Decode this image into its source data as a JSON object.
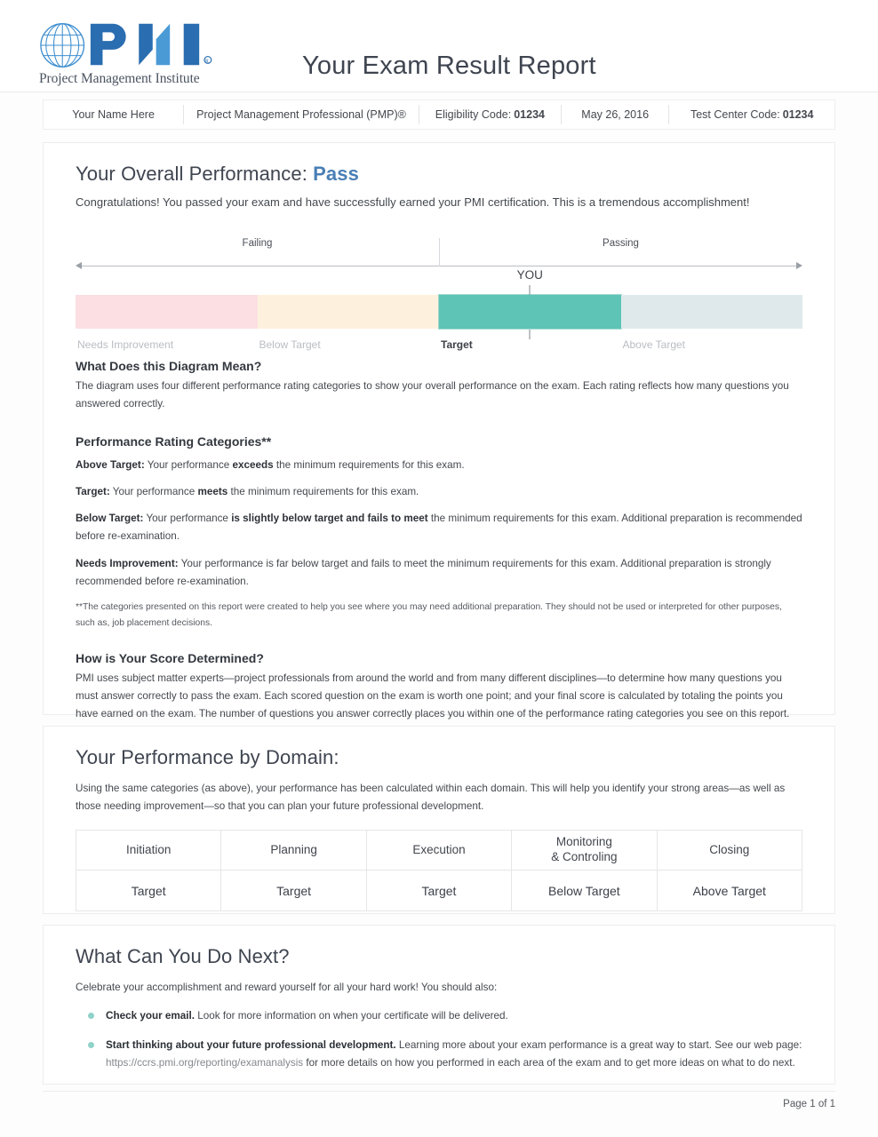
{
  "header": {
    "logo_tagline": "Project Management Institute",
    "report_title": "Your Exam Result Report"
  },
  "infobar": {
    "candidate_name": "Your Name Here",
    "credential": "Project Management Professional (PMP)®",
    "eligibility_label": "Eligibility Code:",
    "eligibility_code": "01234",
    "exam_date": "May 26, 2016",
    "test_center_label": "Test Center Code:",
    "test_center_code": "01234"
  },
  "overall": {
    "title_prefix": "Your Overall Performance:",
    "result": "Pass",
    "congrats": "Congratulations! You passed your exam and have successfully earned your PMI certification. This is a tremendous accomplishment!",
    "diagram_heading": "What Does this Diagram Mean?",
    "diagram_text": "The diagram uses four different performance rating categories to show your overall performance on the exam. Each rating reflects how many questions you answered correctly.",
    "categories_heading": "Performance Rating Categories**",
    "categories": [
      {
        "name": "Above Target:",
        "pre": " Your performance ",
        "emph": "exceeds",
        "post": " the minimum requirements for this exam."
      },
      {
        "name": "Target:",
        "pre": " Your performance ",
        "emph": "meets",
        "post": " the minimum requirements for this exam."
      },
      {
        "name": "Below Target:",
        "pre": " Your performance ",
        "emph": "is slightly below target and fails to meet",
        "post": " the minimum requirements for this exam. Additional preparation is recommended before re-examination."
      },
      {
        "name": "Needs Improvement:",
        "pre": " Your performance is far below target and fails to meet the minimum requirements for this exam. Additional preparation is strongly recommended before re-examination.",
        "emph": "",
        "post": ""
      }
    ],
    "footnote": "**The categories presented on this report were created to help you see where you may need additional preparation. They should not be used or interpreted for other purposes, such as, job placement decisions.",
    "score_heading": "How is Your Score Determined?",
    "score_text": "PMI uses subject matter experts—project professionals from around the world and from many different disciplines—to determine how many questions you must answer correctly to pass the exam. Each scored question on the exam is worth one point; and your final score is calculated by totaling the points you have earned on the exam. The number of questions you answer correctly places you within one of the performance rating categories you see on this report."
  },
  "chart_data": {
    "type": "bar",
    "title": "Overall Performance Rating Scale",
    "orientation": "horizontal-segments",
    "categories": [
      "Needs Improvement",
      "Below Target",
      "Target",
      "Above Target"
    ],
    "segment_colors": [
      "#fbdfe2",
      "#fdf1dd",
      "#5ec4b6",
      "#dfe9ec"
    ],
    "values": [
      1,
      1,
      1,
      1
    ],
    "zone_labels": [
      "Failing",
      "Passing"
    ],
    "zone_split_pct": 50,
    "marker_label": "YOU",
    "marker_position_pct": 62.5,
    "selected_category": "Target",
    "legend": "none",
    "grid": false
  },
  "domain": {
    "title": "Your Performance by Domain:",
    "intro": "Using the same categories (as above), your performance has been calculated within each domain. This will help you identify your strong areas—as well as those needing improvement—so that you can plan your future professional development.",
    "columns": [
      "Initiation",
      "Planning",
      "Execution",
      "Monitoring\n& Controling",
      "Closing"
    ],
    "results": [
      "Target",
      "Target",
      "Target",
      "Below Target",
      "Above Target"
    ]
  },
  "next": {
    "title": "What Can You Do Next?",
    "intro": "Celebrate your accomplishment and reward yourself for all your hard work! You should also:",
    "items": [
      {
        "lead": "Check your email.",
        "rest": " Look for more information on when your certificate will be delivered.",
        "url": "",
        "tail": ""
      },
      {
        "lead": "Start thinking about your future professional development.",
        "rest": " Learning more about your exam performance is a great way to start. See our web page: ",
        "url": "https://ccrs.pmi.org/reporting/examanalysis",
        "tail": " for more details on how you performed in each area of the exam and to get more ideas on what to do next."
      }
    ]
  },
  "footer": {
    "page_label": "Page 1 of 1"
  }
}
